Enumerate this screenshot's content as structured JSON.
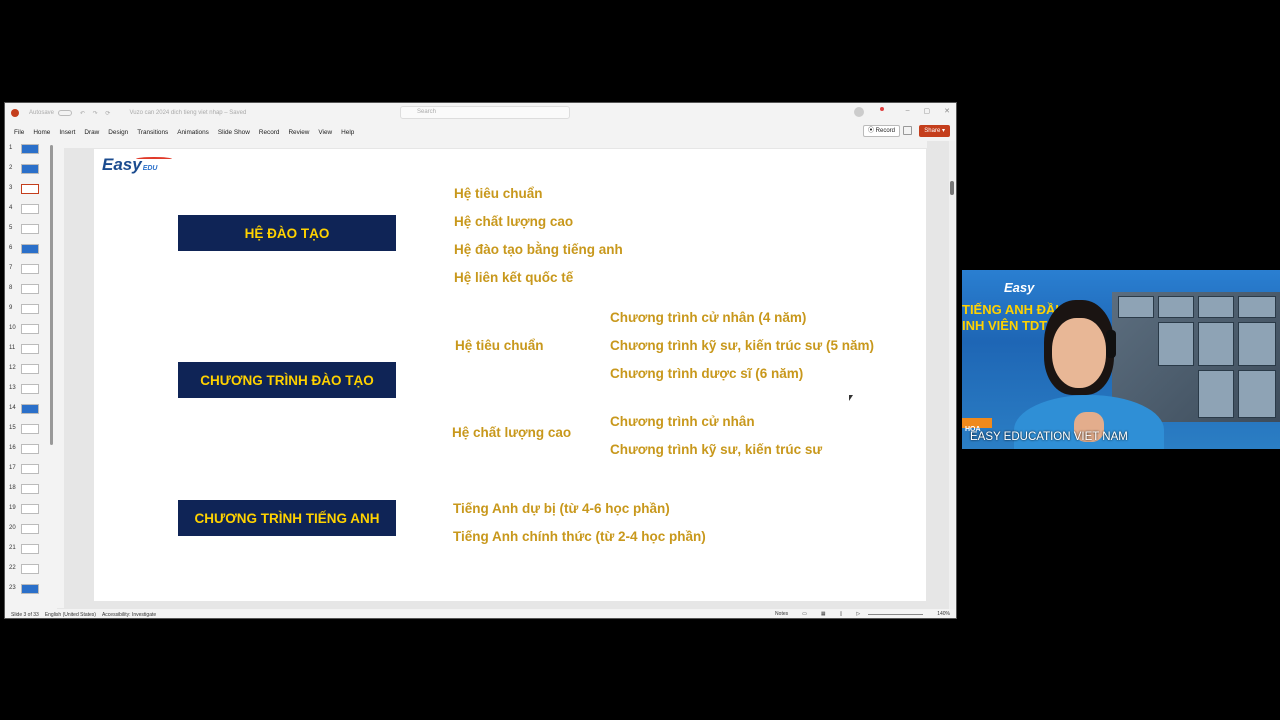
{
  "window": {
    "autosave_label": "Autosave",
    "doc_title": "Vuzo can 2024 dich tieng viet nhap – Saved",
    "search_placeholder": "Search"
  },
  "menu": [
    "File",
    "Home",
    "Insert",
    "Draw",
    "Design",
    "Transitions",
    "Animations",
    "Slide Show",
    "Record",
    "Review",
    "View",
    "Help"
  ],
  "toolbar": {
    "record_label": "Record",
    "share_label": "Share"
  },
  "thumbnails": [
    "1",
    "2",
    "3",
    "4",
    "5",
    "6",
    "7",
    "8",
    "9",
    "10",
    "11",
    "12",
    "13",
    "14",
    "15",
    "16",
    "17",
    "18",
    "19",
    "20",
    "21",
    "22",
    "23"
  ],
  "slide": {
    "logo": "Easy",
    "logo_sub": "EDU",
    "box1": "HỆ ĐÀO TẠO",
    "box2": "CHƯƠNG TRÌNH ĐÀO TẠO",
    "box3": "CHƯƠNG TRÌNH TIẾNG ANH",
    "he_dao_tao": [
      "Hệ tiêu chuẩn",
      "Hệ chất lượng cao",
      "Hệ đào tạo bằng tiếng anh",
      "Hệ liên kết quốc tế"
    ],
    "ct_tieu_chuan_label": "Hệ tiêu chuẩn",
    "ct_tieu_chuan": [
      "Chương trình cử nhân (4 năm)",
      "Chương trình kỹ sư, kiến trúc sư (5 năm)",
      "Chương trình dược sĩ (6 năm)"
    ],
    "ct_clc_label": "Hệ chất lượng cao",
    "ct_clc": [
      "Chương trình cử nhân",
      "Chương trình kỹ sư, kiến trúc sư"
    ],
    "tieng_anh": [
      "Tiếng Anh dự bị (từ 4-6 học phần)",
      "Tiếng Anh chính thức (từ 2-4 học phần)"
    ]
  },
  "status": {
    "slide_info": "Slide 3 of 33",
    "language": "English (United States)",
    "accessibility": "Accessibility: Investigate",
    "notes": "Notes",
    "zoom": "140%"
  },
  "webcam": {
    "logo": "Easy",
    "banner_line1": "TIẾNG ANH ĐẦU V",
    "banner_line2": "INH VIÊN TDT",
    "tag": "HOA",
    "caption": "EASY EDUCATION VIET NAM"
  }
}
